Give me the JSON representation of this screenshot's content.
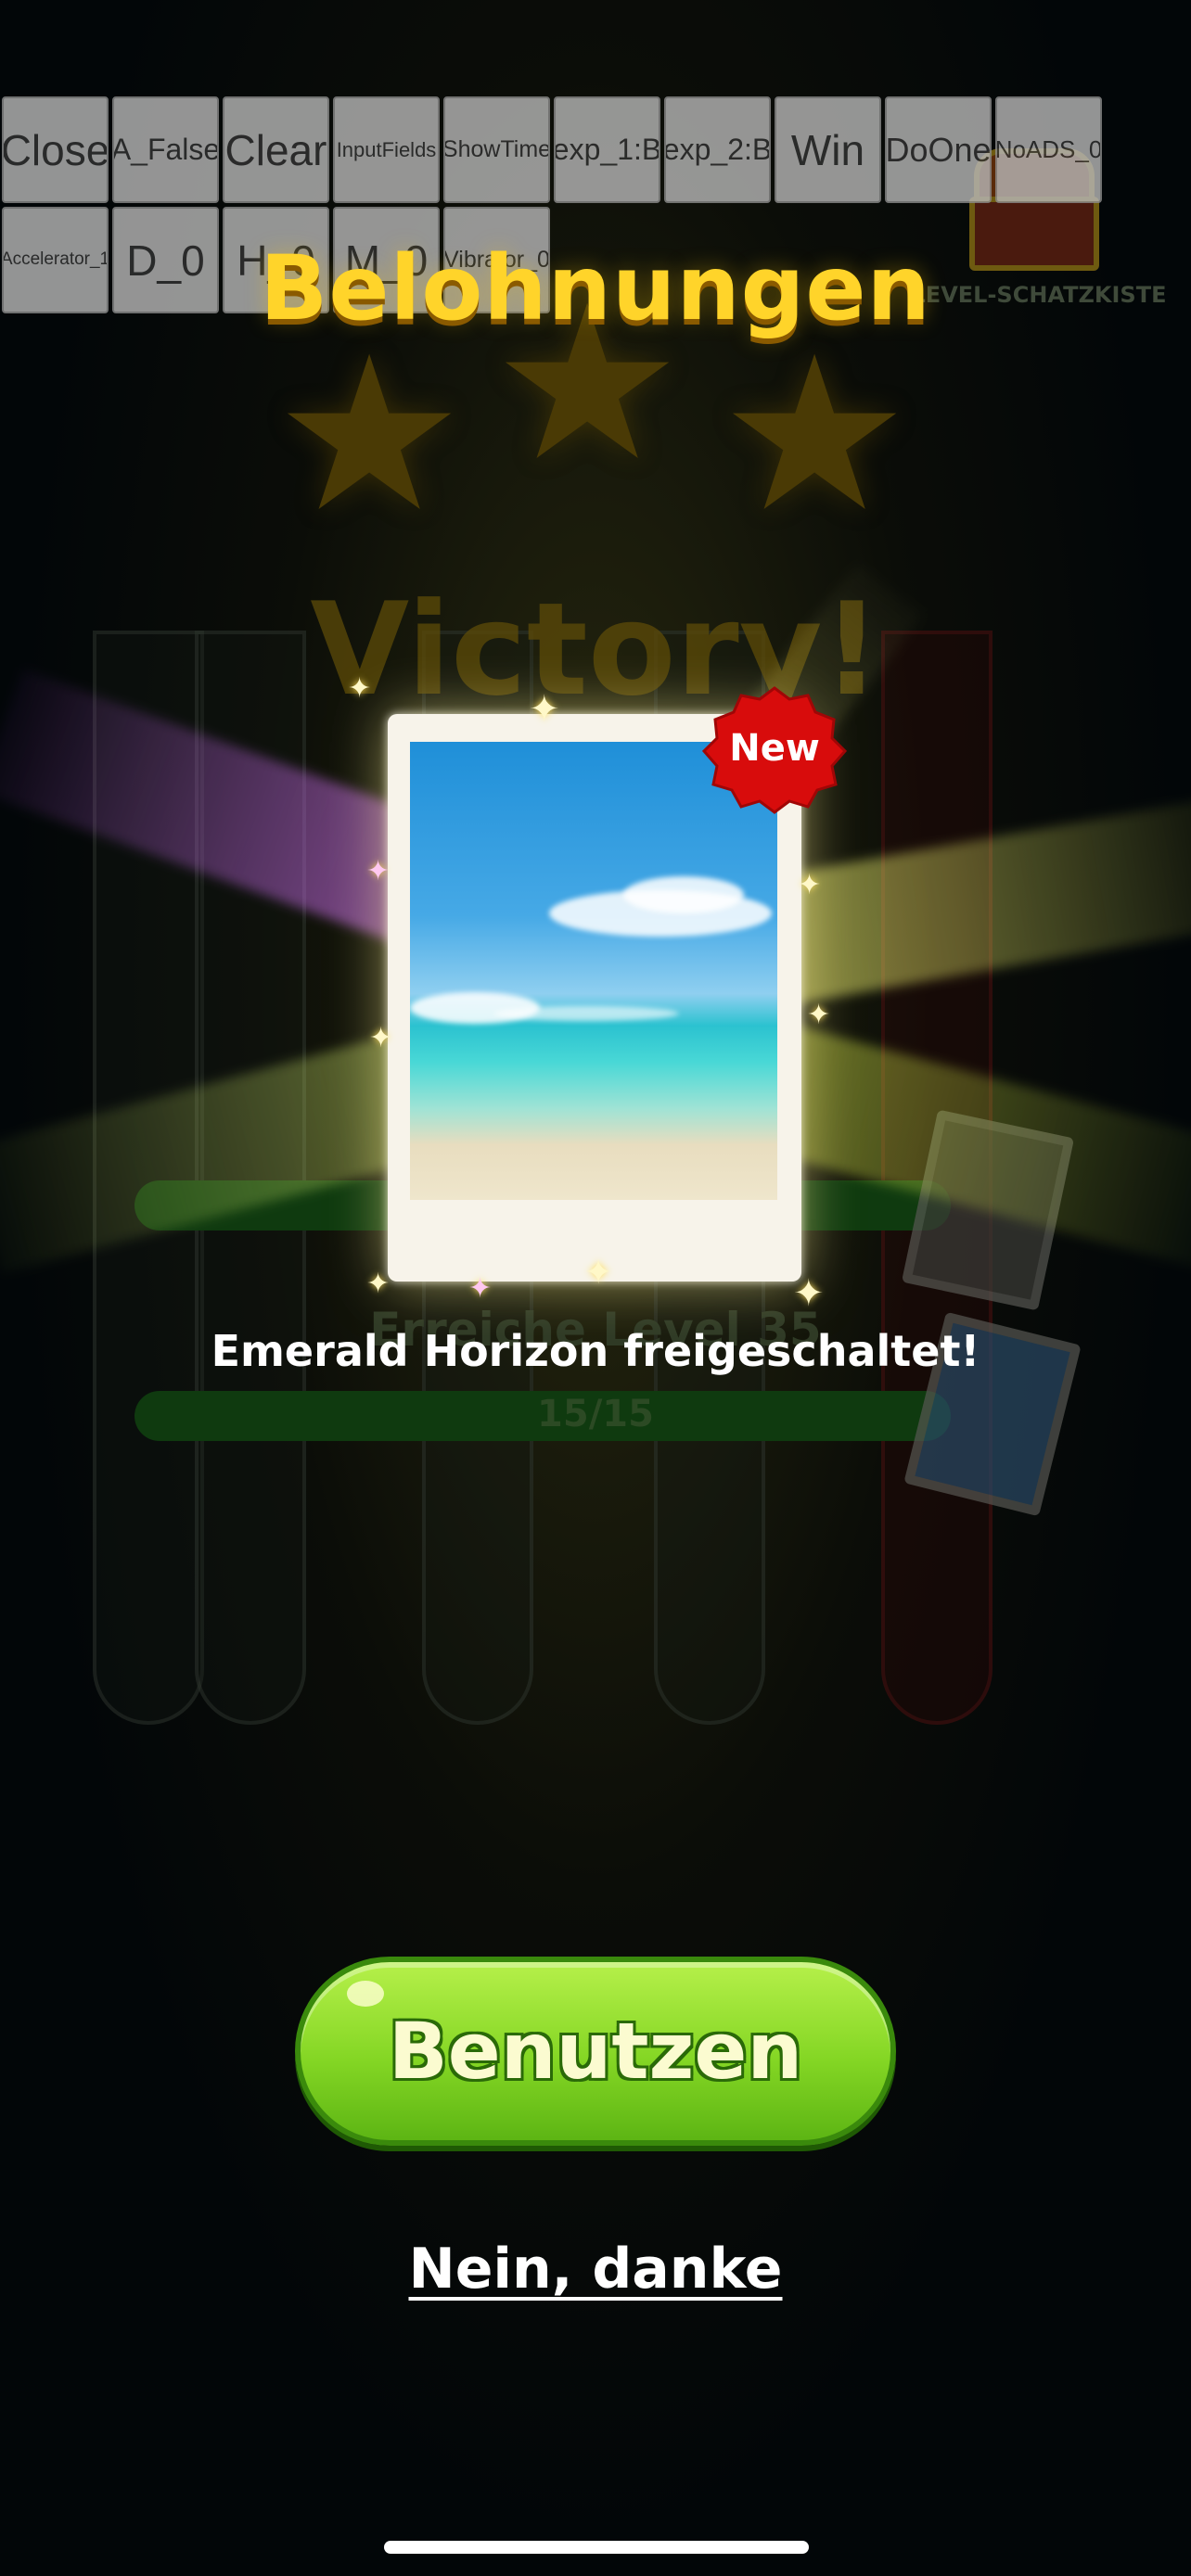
{
  "debug_buttons": [
    {
      "label": "Close"
    },
    {
      "label": "A_False"
    },
    {
      "label": "Clear"
    },
    {
      "label": "InputFields"
    },
    {
      "label": "ShowTime"
    },
    {
      "label": "exp_1:B"
    },
    {
      "label": "exp_2:B"
    },
    {
      "label": "Win"
    },
    {
      "label": "DoOne"
    },
    {
      "label": "NoADS_0"
    },
    {
      "label": "Accelerator_1"
    },
    {
      "label": "D_0"
    },
    {
      "label": "H_0"
    },
    {
      "label": "M_0"
    },
    {
      "label": "Vibrator_0"
    }
  ],
  "header": {
    "title": "Belohnungen",
    "treasure_label": "LEVEL-SCHATZKISTE"
  },
  "background": {
    "victory_text": "Victory!",
    "level_text": "Erreiche Level 35",
    "progress_text": "15/15"
  },
  "reward": {
    "badge_label": "New",
    "unlock_message": "Emerald Horizon freigeschaltet!"
  },
  "actions": {
    "use_label": "Benutzen",
    "decline_label": "Nein, danke"
  },
  "colors": {
    "title": "#ffd42a",
    "use_button": "#84d624",
    "badge": "#d80c0c"
  }
}
